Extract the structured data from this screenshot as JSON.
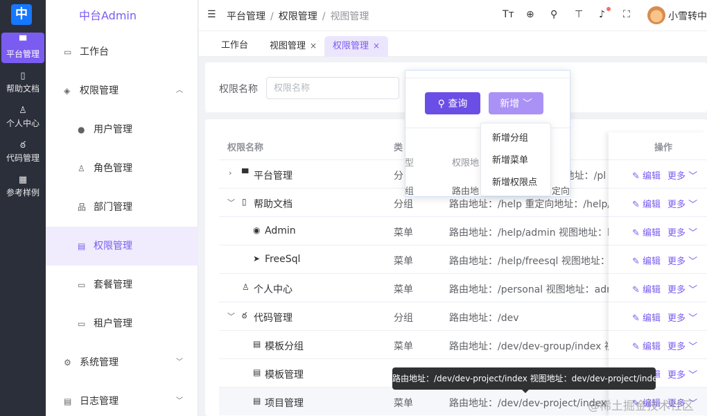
{
  "rail": {
    "logo": "中",
    "items": [
      {
        "label": "平台管理",
        "icon": "▀"
      },
      {
        "label": "帮助文档",
        "icon": "▯"
      },
      {
        "label": "个人中心",
        "icon": "♙"
      },
      {
        "label": "代码管理",
        "icon": "ఠ"
      },
      {
        "label": "参考样例",
        "icon": "▦"
      }
    ]
  },
  "sidebar": {
    "brand": "中台Admin",
    "items": [
      {
        "label": "工作台",
        "icon": "▭"
      },
      {
        "label": "权限管理",
        "icon": "◈",
        "arrow": "︿"
      },
      {
        "label": "用户管理",
        "icon": "●"
      },
      {
        "label": "角色管理",
        "icon": "♙"
      },
      {
        "label": "部门管理",
        "icon": "品"
      },
      {
        "label": "权限管理",
        "icon": "▤"
      },
      {
        "label": "套餐管理",
        "icon": "▭"
      },
      {
        "label": "租户管理",
        "icon": "▭"
      },
      {
        "label": "系统管理",
        "icon": "⚙",
        "arrow": "﹀"
      },
      {
        "label": "日志管理",
        "icon": "▤",
        "arrow": "﹀"
      }
    ]
  },
  "header": {
    "menu_icon": "☰",
    "breadcrumb": [
      "平台管理",
      "权限管理",
      "视图管理"
    ],
    "separator": "/",
    "icons": {
      "font": "Tт",
      "globe": "⊕",
      "search": "⚲",
      "shirt": "⊤",
      "bell": "♪",
      "fullscreen": "⛶"
    },
    "username": "小雪转中"
  },
  "tabs": [
    {
      "label": "工作台"
    },
    {
      "label": "视图管理",
      "close": "×"
    },
    {
      "label": "权限管理",
      "close": "×"
    }
  ],
  "search": {
    "label": "权限名称",
    "placeholder": "权限名称",
    "query_button": "⚲ 查询",
    "add_button": "新增 ﹀"
  },
  "add_menu": [
    "新增分组",
    "新增菜单",
    "新增权限点"
  ],
  "popover_ghost": {
    "type": "型",
    "route_header": "权限地",
    "group": "组",
    "route": "路由地",
    "redirect": "定向"
  },
  "table": {
    "headers": {
      "name": "权限名称",
      "type": "类",
      "ops": "操作"
    },
    "edit_label": "✎ 编辑",
    "more_label": "更多 ﹀",
    "rows": [
      {
        "caret": "›",
        "icon": "▀",
        "name": "平台管理",
        "type": "分",
        "route": "路由地址：/platform 视图地址：/pl"
      },
      {
        "caret": "﹀",
        "icon": "▯",
        "name": "帮助文档",
        "type": "分组",
        "route": "路由地址：/help 重定向地址：/help/a"
      },
      {
        "caret": "",
        "icon": "◉",
        "name": "Admin",
        "type": "菜单",
        "route": "路由地址：/help/admin 视图地址：la"
      },
      {
        "caret": "",
        "icon": "➤",
        "name": "FreeSql",
        "type": "菜单",
        "route": "路由地址：/help/freesql 视图地址：la"
      },
      {
        "caret": "",
        "icon": "♙",
        "name": "个人中心",
        "type": "菜单",
        "route": "路由地址：/personal 视图地址：adm"
      },
      {
        "caret": "﹀",
        "icon": "ఠ",
        "name": "代码管理",
        "type": "分组",
        "route": "路由地址：/dev"
      },
      {
        "caret": "",
        "icon": "▤",
        "name": "模板分组",
        "type": "菜单",
        "route": "路由地址：/dev/dev-group/index 视图"
      },
      {
        "caret": "",
        "icon": "▤",
        "name": "模板管理",
        "type": "",
        "route": ""
      },
      {
        "caret": "",
        "icon": "▤",
        "name": "项目管理",
        "type": "菜单",
        "route": "路由地址：/dev/dev-project/index 视图"
      }
    ]
  },
  "tooltip": "路由地址：/dev/dev-project/index 视图地址：dev/dev-project/index",
  "watermark": "@稀土掘金技术社区",
  "colors": {
    "accent": "#7b5cf0",
    "rail": "#2b2f3a",
    "query_button": "#6b4ee6",
    "add_button": "#a991f5"
  }
}
